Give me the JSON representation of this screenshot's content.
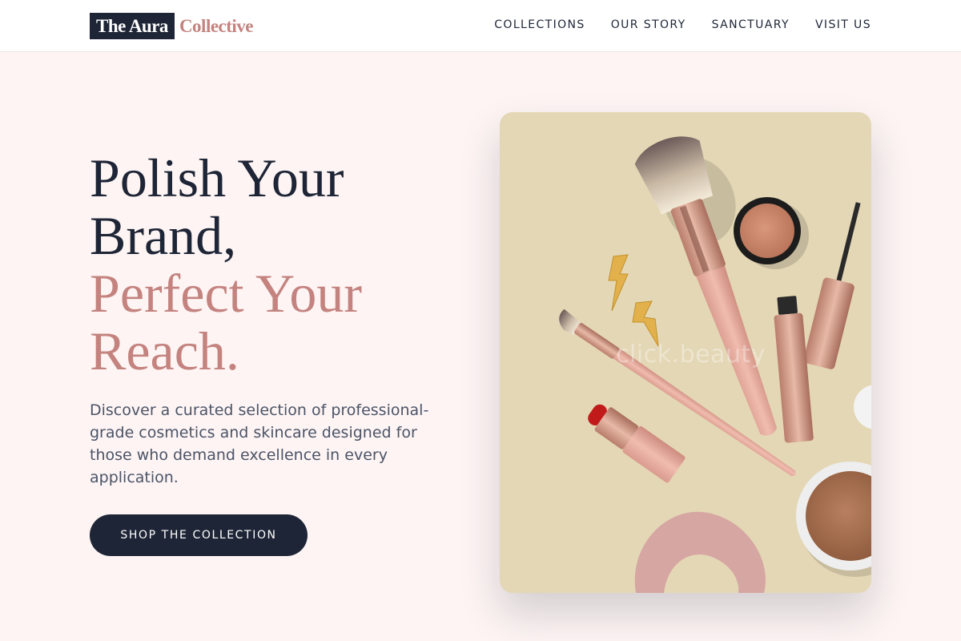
{
  "brand": {
    "name_primary": "The Aura",
    "name_accent": "Collective"
  },
  "nav": {
    "items": [
      {
        "label": "COLLECTIONS"
      },
      {
        "label": "OUR STORY"
      },
      {
        "label": "SANCTUARY"
      },
      {
        "label": "VISIT US"
      }
    ]
  },
  "hero": {
    "title_line1": "Polish Your",
    "title_line2": "Brand,",
    "title_line3": "Perfect Your",
    "title_line4": "Reach.",
    "description": "Discover a curated selection of professional-grade cosmetics and skincare designed for those who demand excellence in every application.",
    "cta_label": "SHOP THE COLLECTION"
  },
  "image": {
    "watermark": "click.beauty",
    "subject": "flat-lay of makeup brushes, lipstick, mascara, compact powder, eyeshadow, scrunchie and lightning-bolt earrings on beige background"
  },
  "colors": {
    "navy": "#1e2536",
    "rose": "#c4837f",
    "background": "#fdf4f3",
    "card_beige": "#e4d7b5"
  }
}
